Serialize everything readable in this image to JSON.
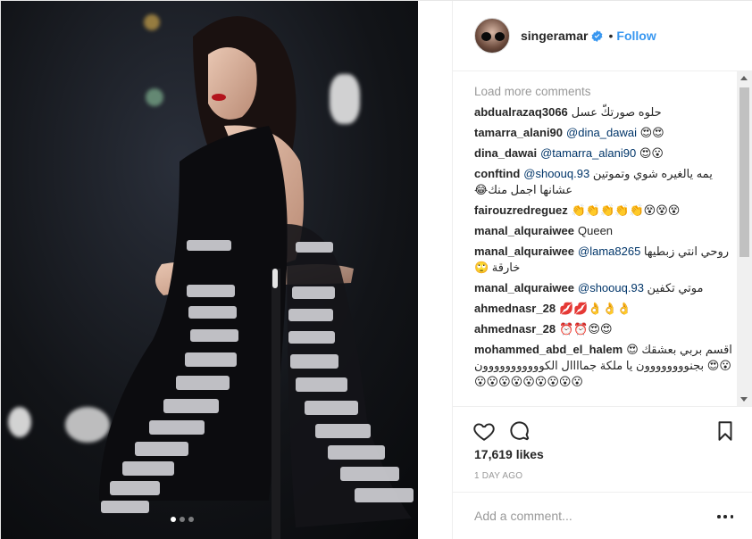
{
  "header": {
    "username": "singeramar",
    "separator": "•",
    "follow_label": "Follow"
  },
  "comments": {
    "load_more_label": "Load more comments",
    "items": [
      {
        "user": "abdualrazaq3066",
        "mention": "",
        "text": "حلوه صورتكّ عسل"
      },
      {
        "user": "tamarra_alani90",
        "mention": "@dina_dawai",
        "text": "😍😍"
      },
      {
        "user": "dina_dawai",
        "mention": "@tamarra_alani90",
        "text": "😍😮"
      },
      {
        "user": "conftind",
        "mention": "@shoouq.93",
        "text": "يمه يالغيره شوي وتموتين عشانها اجمل منك😂"
      },
      {
        "user": "fairouzredreguez",
        "mention": "",
        "text": "👏👏👏👏👏😵😵😵"
      },
      {
        "user": "manal_alquraiwee",
        "mention": "",
        "text": "Queen"
      },
      {
        "user": "manal_alquraiwee",
        "mention": "@lama8265",
        "text": "روحي انتي زبطيها خارقة 🙄"
      },
      {
        "user": "manal_alquraiwee",
        "mention": "@shoouq.93",
        "text": "موتي تكفين"
      },
      {
        "user": "ahmednasr_28",
        "mention": "",
        "text": "💋💋👌👌👌"
      },
      {
        "user": "ahmednasr_28",
        "mention": "",
        "text": "⏰⏰😍😍"
      },
      {
        "user": "mohammed_abd_el_halem",
        "mention": "",
        "text": "اقسم بربي بعشقك 😍😮😍 بجنوووووووون يا ملكة جماااال الكووووووووووون 😮😮😮😮😮😮😮😮😮"
      }
    ]
  },
  "post": {
    "likes": "17,619 likes",
    "date": "1 DAY AGO"
  },
  "add_comment": {
    "placeholder": "Add a comment..."
  },
  "icons": {
    "verified": "verified-badge-icon",
    "like": "heart-icon",
    "comment": "comment-bubble-icon",
    "save": "bookmark-icon",
    "more": "more-options-icon"
  },
  "colors": {
    "link": "#3897f0",
    "mention": "#003569",
    "text": "#262626",
    "muted": "#999999",
    "border": "#efefef"
  }
}
